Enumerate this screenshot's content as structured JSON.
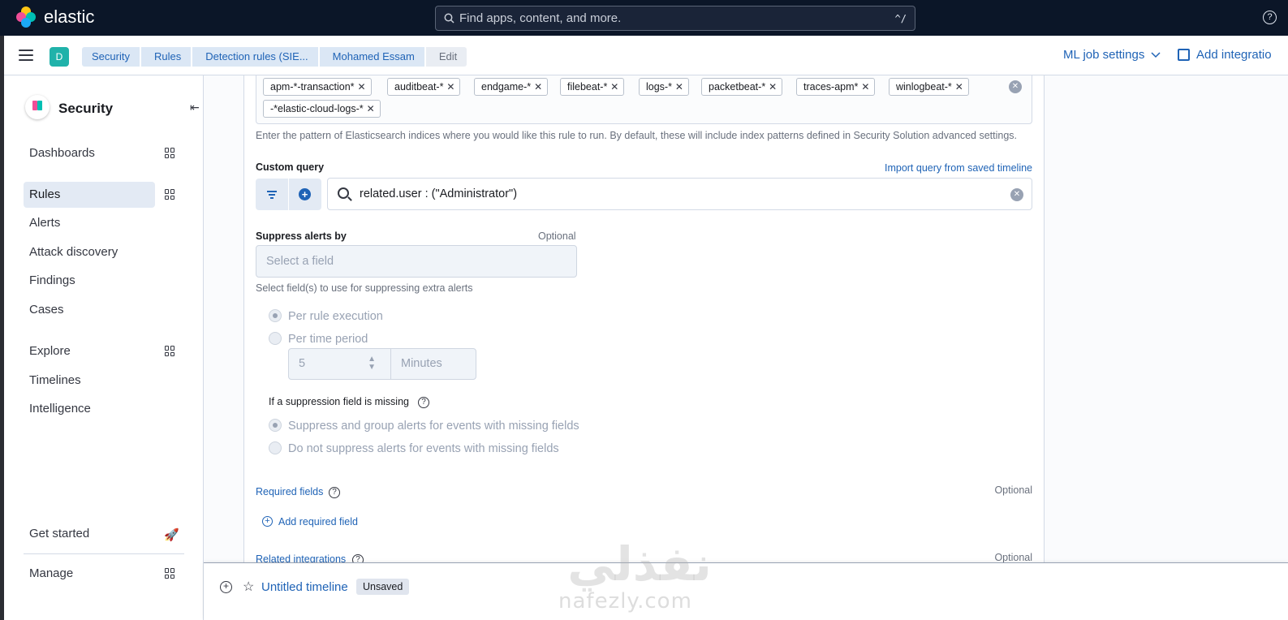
{
  "header": {
    "brand": "elastic",
    "search_placeholder": "Find apps, content, and more.",
    "search_shortcut": "^/",
    "help_icon": "help-icon"
  },
  "navbar": {
    "space_initial": "D",
    "breadcrumbs": [
      "Security",
      "Rules",
      "Detection rules (SIE...",
      "Mohamed Essam",
      "Edit"
    ],
    "ml_job_settings": "ML job settings",
    "add_integrations": "Add integratio"
  },
  "sidebar": {
    "title": "Security",
    "items": [
      {
        "label": "Dashboards"
      },
      {
        "label": "Rules"
      },
      {
        "label": "Alerts"
      },
      {
        "label": "Attack discovery"
      },
      {
        "label": "Findings"
      },
      {
        "label": "Cases"
      },
      {
        "label": "Explore"
      },
      {
        "label": "Timelines"
      },
      {
        "label": "Intelligence"
      },
      {
        "label": "Get started"
      },
      {
        "label": "Manage"
      }
    ]
  },
  "form": {
    "index_patterns": [
      "apm-*-transaction*",
      "auditbeat-*",
      "endgame-*",
      "filebeat-*",
      "logs-*",
      "packetbeat-*",
      "traces-apm*",
      "winlogbeat-*",
      "-*elastic-cloud-logs-*"
    ],
    "index_help": "Enter the pattern of Elasticsearch indices where you would like this rule to run. By default, these will include index patterns defined in Security Solution advanced settings.",
    "custom_query_label": "Custom query",
    "import_query_link": "Import query from saved timeline",
    "query_value": "related.user : (\"Administrator\")",
    "suppress_label": "Suppress alerts by",
    "optional": "Optional",
    "suppress_placeholder": "Select a field",
    "suppress_help": "Select field(s) to use for suppressing extra alerts",
    "per_rule_execution": "Per rule execution",
    "per_time_period": "Per time period",
    "time_value": "5",
    "time_unit": "Minutes",
    "missing_label": "If a suppression field is missing",
    "missing_option_1": "Suppress and group alerts for events with missing fields",
    "missing_option_2": "Do not suppress alerts for events with missing fields",
    "required_fields_label": "Required fields",
    "add_required_field": "Add required field",
    "related_integrations_label": "Related integrations"
  },
  "timeline": {
    "title": "Untitled timeline",
    "status": "Unsaved"
  },
  "watermark": {
    "text": "nafezly.com"
  }
}
